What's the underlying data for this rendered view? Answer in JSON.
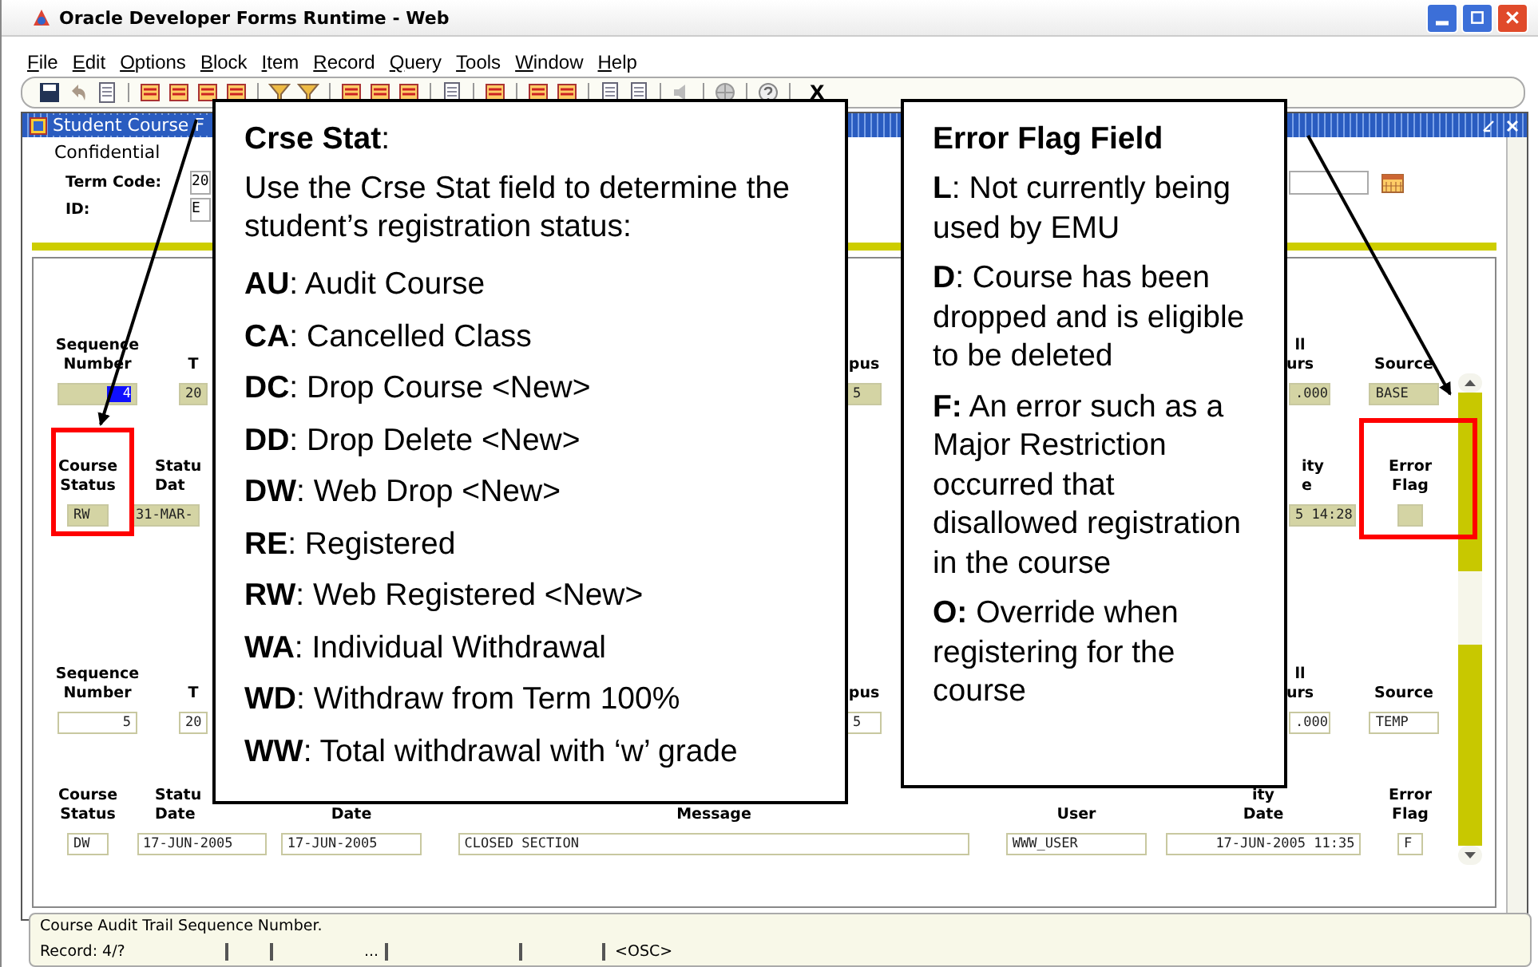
{
  "window": {
    "title": "Oracle Developer Forms Runtime - Web"
  },
  "menu": [
    "File",
    "Edit",
    "Options",
    "Block",
    "Item",
    "Record",
    "Query",
    "Tools",
    "Window",
    "Help"
  ],
  "toolbar": {
    "exit_label": "X"
  },
  "form": {
    "title": "Student Course F",
    "classification": "Confidential",
    "fields": [
      {
        "label": "Term Code:",
        "value": "20"
      },
      {
        "label": "ID:",
        "value": "E"
      }
    ]
  },
  "records": [
    {
      "current": true,
      "row_a": [
        {
          "kind": "sequence",
          "label": "Sequence\nNumber",
          "value": "4",
          "highlighted": true
        },
        {
          "kind": "term",
          "label": "T",
          "value": "20",
          "highlighted": false
        },
        {
          "kind": "campus",
          "label": "pus",
          "value": "5",
          "highlighted": false
        },
        {
          "kind": "hours",
          "label": "ll\nurs",
          "value": ".000",
          "highlighted": false
        },
        {
          "kind": "source",
          "label": "Source",
          "value": "BASE",
          "highlighted": false
        }
      ],
      "row_b": [
        {
          "kind": "course_status",
          "label": "Course\nStatus",
          "value": "RW"
        },
        {
          "kind": "status_date_partial",
          "label": "Statu\nDat",
          "value": "31-MAR-"
        },
        {
          "kind": "activity_date_partial",
          "label": "ity\ne",
          "value": "5 14:28"
        },
        {
          "kind": "error_flag",
          "label": "Error\nFlag"
        }
      ]
    },
    {
      "current": false,
      "row_a": [
        {
          "kind": "sequence",
          "label": "Sequence\nNumber",
          "value": "5",
          "highlighted": false
        },
        {
          "kind": "term",
          "label": "T",
          "value": "20",
          "highlighted": false
        },
        {
          "kind": "campus",
          "label": "pus",
          "value": "5",
          "highlighted": false
        },
        {
          "kind": "hours",
          "label": "ll\nurs",
          "value": ".000",
          "highlighted": false
        },
        {
          "kind": "source",
          "label": "Source",
          "value": "TEMP",
          "highlighted": false
        }
      ],
      "row_b": [
        {
          "kind": "course_status",
          "label": "Course\nStatus",
          "value": "DW"
        },
        {
          "kind": "status_date",
          "label": "Statu\nDate",
          "value": "17-JUN-2005"
        },
        {
          "kind": "date",
          "label": "Date",
          "value": "17-JUN-2005"
        },
        {
          "kind": "message",
          "label": "Message",
          "value": "CLOSED SECTION"
        },
        {
          "kind": "user",
          "label": "User",
          "value": "WWW_USER"
        },
        {
          "kind": "activity_date",
          "label": "ity\nDate",
          "value": "17-JUN-2005 11:35"
        },
        {
          "kind": "error_flag",
          "label": "Error\nFlag",
          "value": "F"
        }
      ]
    }
  ],
  "status_bar": {
    "hint": "Course Audit Trail Sequence Number.",
    "record": "Record: 4/?",
    "pager": "...",
    "mode": "<OSC>"
  },
  "callouts": [
    {
      "title": "**Crse Stat**:",
      "intro": "Use the Crse Stat field to determine the student’s registration status:",
      "items": [
        "**AU**: Audit Course",
        "**CA**: Cancelled Class",
        "**DC**: Drop Course <New>",
        "**DD**: Drop Delete <New>",
        "**DW**: Web Drop <New>",
        "**RE**: Registered",
        "**RW**: Web Registered <New>",
        "**WA**: Individual Withdrawal",
        "**WD**: Withdraw from Term 100%",
        "**WW**: Total withdrawal with ‘w’ grade"
      ]
    },
    {
      "title": "Error Flag Field",
      "items": [
        "**L**: Not currently being used by EMU",
        "**D**: Course has been dropped and is eligible to be deleted",
        "**F:** An error such as a Major Restriction occurred that disallowed registration in the course",
        "**O:** Override when registering for the course"
      ]
    }
  ]
}
